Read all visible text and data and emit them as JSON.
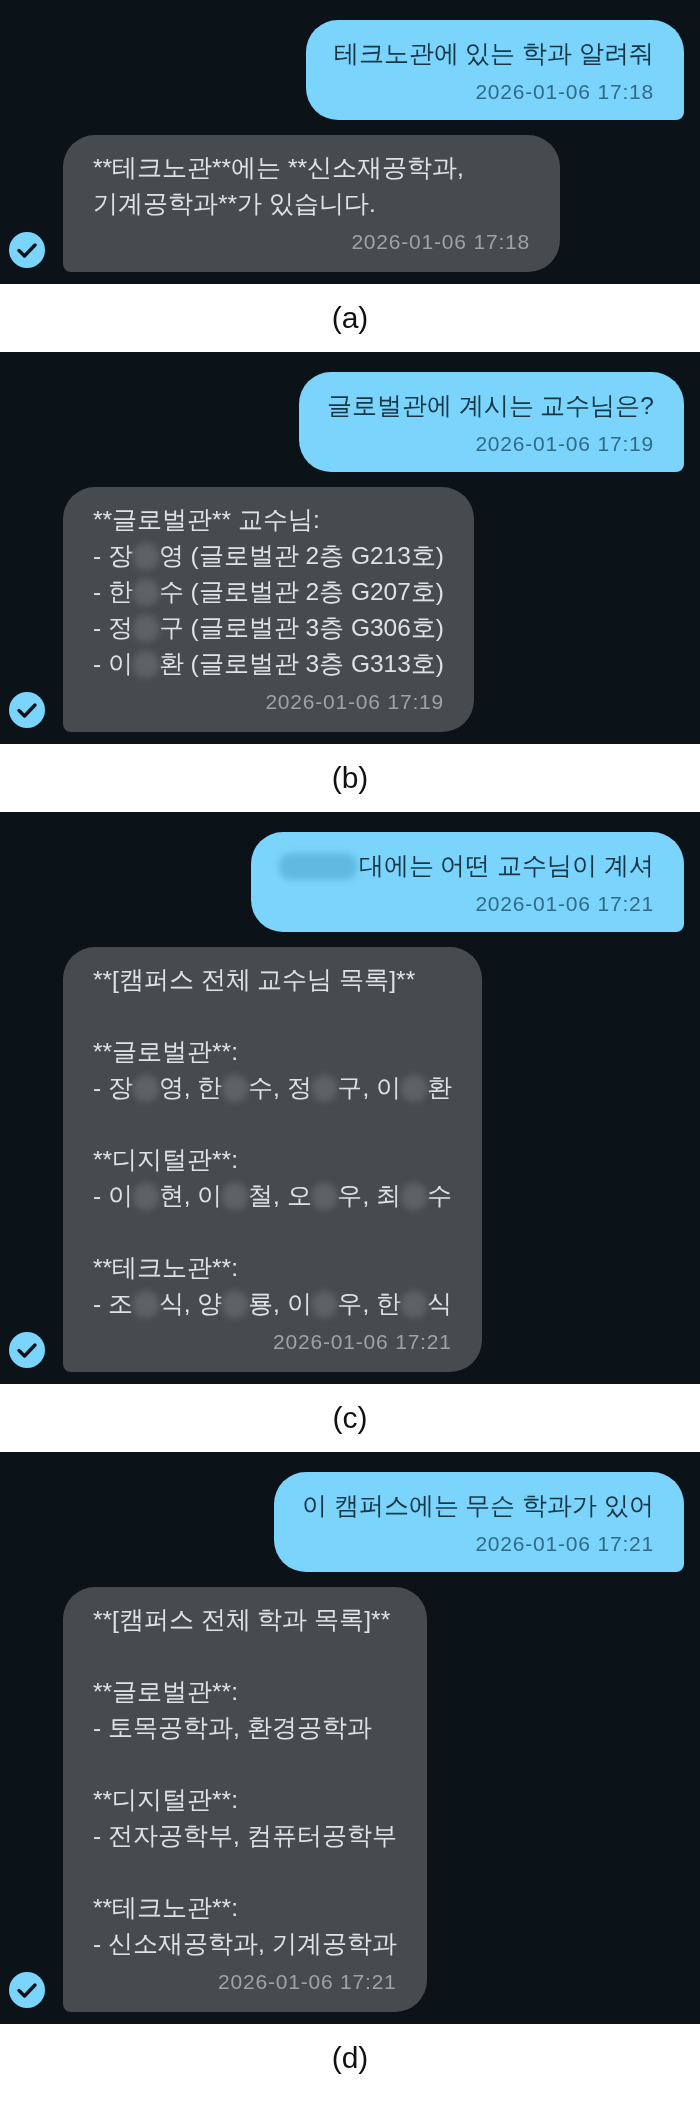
{
  "panels": [
    {
      "caption": "(a)",
      "messages": [
        {
          "kind": "user",
          "paragraphs": [
            {
              "lines": [
                {
                  "segments": [
                    "테크노관에 있는 학과 알려줘"
                  ]
                }
              ]
            }
          ],
          "time": "2026-01-06 17:18"
        },
        {
          "kind": "bot",
          "paragraphs": [
            {
              "lines": [
                {
                  "segments": [
                    "**테크노관**에는 **신소재공학과, 기계공학과**가 있습니다."
                  ]
                }
              ]
            }
          ],
          "time": "2026-01-06 17:18"
        }
      ]
    },
    {
      "caption": "(b)",
      "messages": [
        {
          "kind": "user",
          "paragraphs": [
            {
              "lines": [
                {
                  "segments": [
                    "글로벌관에 계시는 교수님은?"
                  ]
                }
              ]
            }
          ],
          "time": "2026-01-06 17:19"
        },
        {
          "kind": "bot",
          "paragraphs": [
            {
              "lines": [
                {
                  "segments": [
                    "**글로벌관** 교수님:"
                  ]
                },
                {
                  "segments": [
                    "- 장",
                    "영 (글로벌관 2층 G213호)"
                  ]
                },
                {
                  "segments": [
                    "- 한",
                    "수 (글로벌관 2층 G207호)"
                  ]
                },
                {
                  "segments": [
                    "- 정",
                    "구 (글로벌관 3층 G306호)"
                  ]
                },
                {
                  "segments": [
                    "- 이",
                    "환 (글로벌관 3층 G313호)"
                  ]
                }
              ]
            }
          ],
          "time": "2026-01-06 17:19"
        }
      ]
    },
    {
      "caption": "(c)",
      "messages": [
        {
          "kind": "user",
          "paragraphs": [
            {
              "lines": [
                {
                  "lead_blur": true,
                  "segments": [
                    "대에는 어떤 교수님이 계셔"
                  ]
                }
              ]
            }
          ],
          "time": "2026-01-06 17:21"
        },
        {
          "kind": "bot",
          "paragraphs": [
            {
              "lines": [
                {
                  "segments": [
                    "**[캠퍼스 전체 교수님 목록]**"
                  ]
                }
              ]
            },
            {
              "lines": [
                {
                  "segments": [
                    "**글로벌관**:"
                  ]
                },
                {
                  "segments": [
                    "- 장",
                    "영, 한",
                    "수, 정",
                    "구, 이",
                    "환"
                  ]
                }
              ]
            },
            {
              "lines": [
                {
                  "segments": [
                    "**디지털관**:"
                  ]
                },
                {
                  "segments": [
                    "- 이",
                    "현, 이",
                    "철, 오",
                    "우, 최",
                    "수"
                  ]
                }
              ]
            },
            {
              "lines": [
                {
                  "segments": [
                    "**테크노관**:"
                  ]
                },
                {
                  "segments": [
                    "- 조",
                    "식, 양",
                    "룡, 이",
                    "우, 한",
                    "식"
                  ]
                }
              ]
            }
          ],
          "time": "2026-01-06 17:21"
        }
      ]
    },
    {
      "caption": "(d)",
      "messages": [
        {
          "kind": "user",
          "paragraphs": [
            {
              "lines": [
                {
                  "segments": [
                    "이 캠퍼스에는 무슨 학과가 있어"
                  ]
                }
              ]
            }
          ],
          "time": "2026-01-06 17:21"
        },
        {
          "kind": "bot",
          "paragraphs": [
            {
              "lines": [
                {
                  "segments": [
                    "**[캠퍼스 전체 학과 목록]**"
                  ]
                }
              ]
            },
            {
              "lines": [
                {
                  "segments": [
                    "**글로벌관**:"
                  ]
                },
                {
                  "segments": [
                    "- 토목공학과, 환경공학과"
                  ]
                }
              ]
            },
            {
              "lines": [
                {
                  "segments": [
                    "**디지털관**:"
                  ]
                },
                {
                  "segments": [
                    "- 전자공학부, 컴퓨터공학부"
                  ]
                }
              ]
            },
            {
              "lines": [
                {
                  "segments": [
                    "**테크노관**:"
                  ]
                },
                {
                  "segments": [
                    "- 신소재공학과, 기계공학과"
                  ]
                }
              ]
            }
          ],
          "time": "2026-01-06 17:21"
        }
      ]
    }
  ]
}
